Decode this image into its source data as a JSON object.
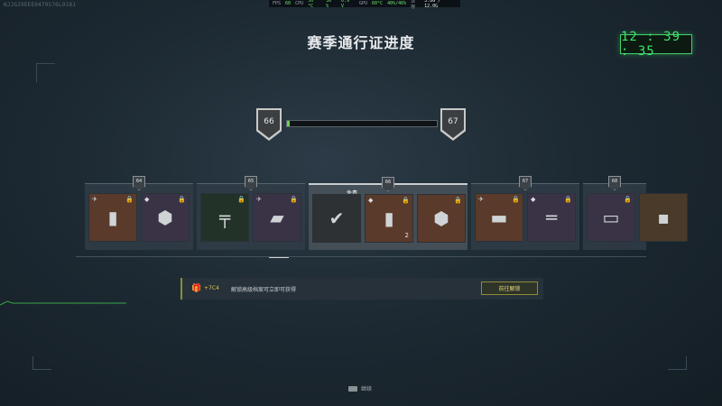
{
  "overlay": {
    "fps_label": "FPS",
    "fps_value": "60",
    "cpu_label": "CPU",
    "cpu_temp": "50 °C",
    "cpu_load": "36 %",
    "cpu_volt": "0.9 V",
    "gpu_label": "GPU",
    "gpu_temp": "60°C",
    "gpu_load": "40%/46%",
    "mem_label": "显存",
    "mem_value": "3.8G / 12.0G"
  },
  "player_id": "NJJG29EEE0479576L9181",
  "title": "赛季通行证进度",
  "clock": "12 : 39 : 35",
  "progress": {
    "current_tier": "66",
    "next_tier": "67",
    "fill_fraction": 0.02
  },
  "tiers": [
    {
      "tier": "64",
      "items": [
        {
          "name": "attachment-stock",
          "bg": "#5a3a2a",
          "lock": true,
          "class_icon": "✈"
        },
        {
          "name": "operator-emblem",
          "bg": "#3a3346",
          "lock": true,
          "class_icon": "◆"
        }
      ]
    },
    {
      "tier": "65",
      "items": [
        {
          "name": "weapon-blueprint-smg",
          "bg": "#233228",
          "lock": true,
          "class_icon": ""
        },
        {
          "name": "weapon-xp-token",
          "bg": "#3a3346",
          "lock": true,
          "class_icon": "✈"
        }
      ]
    },
    {
      "tier": "66",
      "free_label": "免费",
      "items": [
        {
          "name": "claimed-reward",
          "bg": "#2e3133",
          "lock": false,
          "class_icon": ""
        },
        {
          "name": "attachment-stock",
          "bg": "#5a3a2a",
          "lock": true,
          "class_icon": "◆",
          "count": "2"
        },
        {
          "name": "operator-emblem",
          "bg": "#5a3a2a",
          "lock": true,
          "class_icon": ""
        }
      ]
    },
    {
      "tier": "67",
      "items": [
        {
          "name": "attachment-case",
          "bg": "#5a3a2a",
          "lock": true,
          "class_icon": "✈"
        },
        {
          "name": "weapon-blueprint-sniper",
          "bg": "#3a3346",
          "lock": true,
          "class_icon": "◆"
        }
      ]
    },
    {
      "tier": "68",
      "items": [
        {
          "name": "sticker-banner",
          "bg": "#3a3346",
          "lock": true,
          "class_icon": ""
        },
        {
          "name": "partial-item",
          "bg": "#4a3a2a",
          "lock": false,
          "class_icon": ""
        }
      ]
    }
  ],
  "unlock": {
    "gift_icon": "gift-icon",
    "cp_amount": "+7C4",
    "text": "解锁高级档案可立即可获得",
    "button_label": "前往解锁"
  },
  "footer": {
    "continue_label": "继续"
  },
  "colors": {
    "accent_green": "#3fe06a",
    "progress_green": "#6ed34a",
    "gold": "#e0c656"
  }
}
